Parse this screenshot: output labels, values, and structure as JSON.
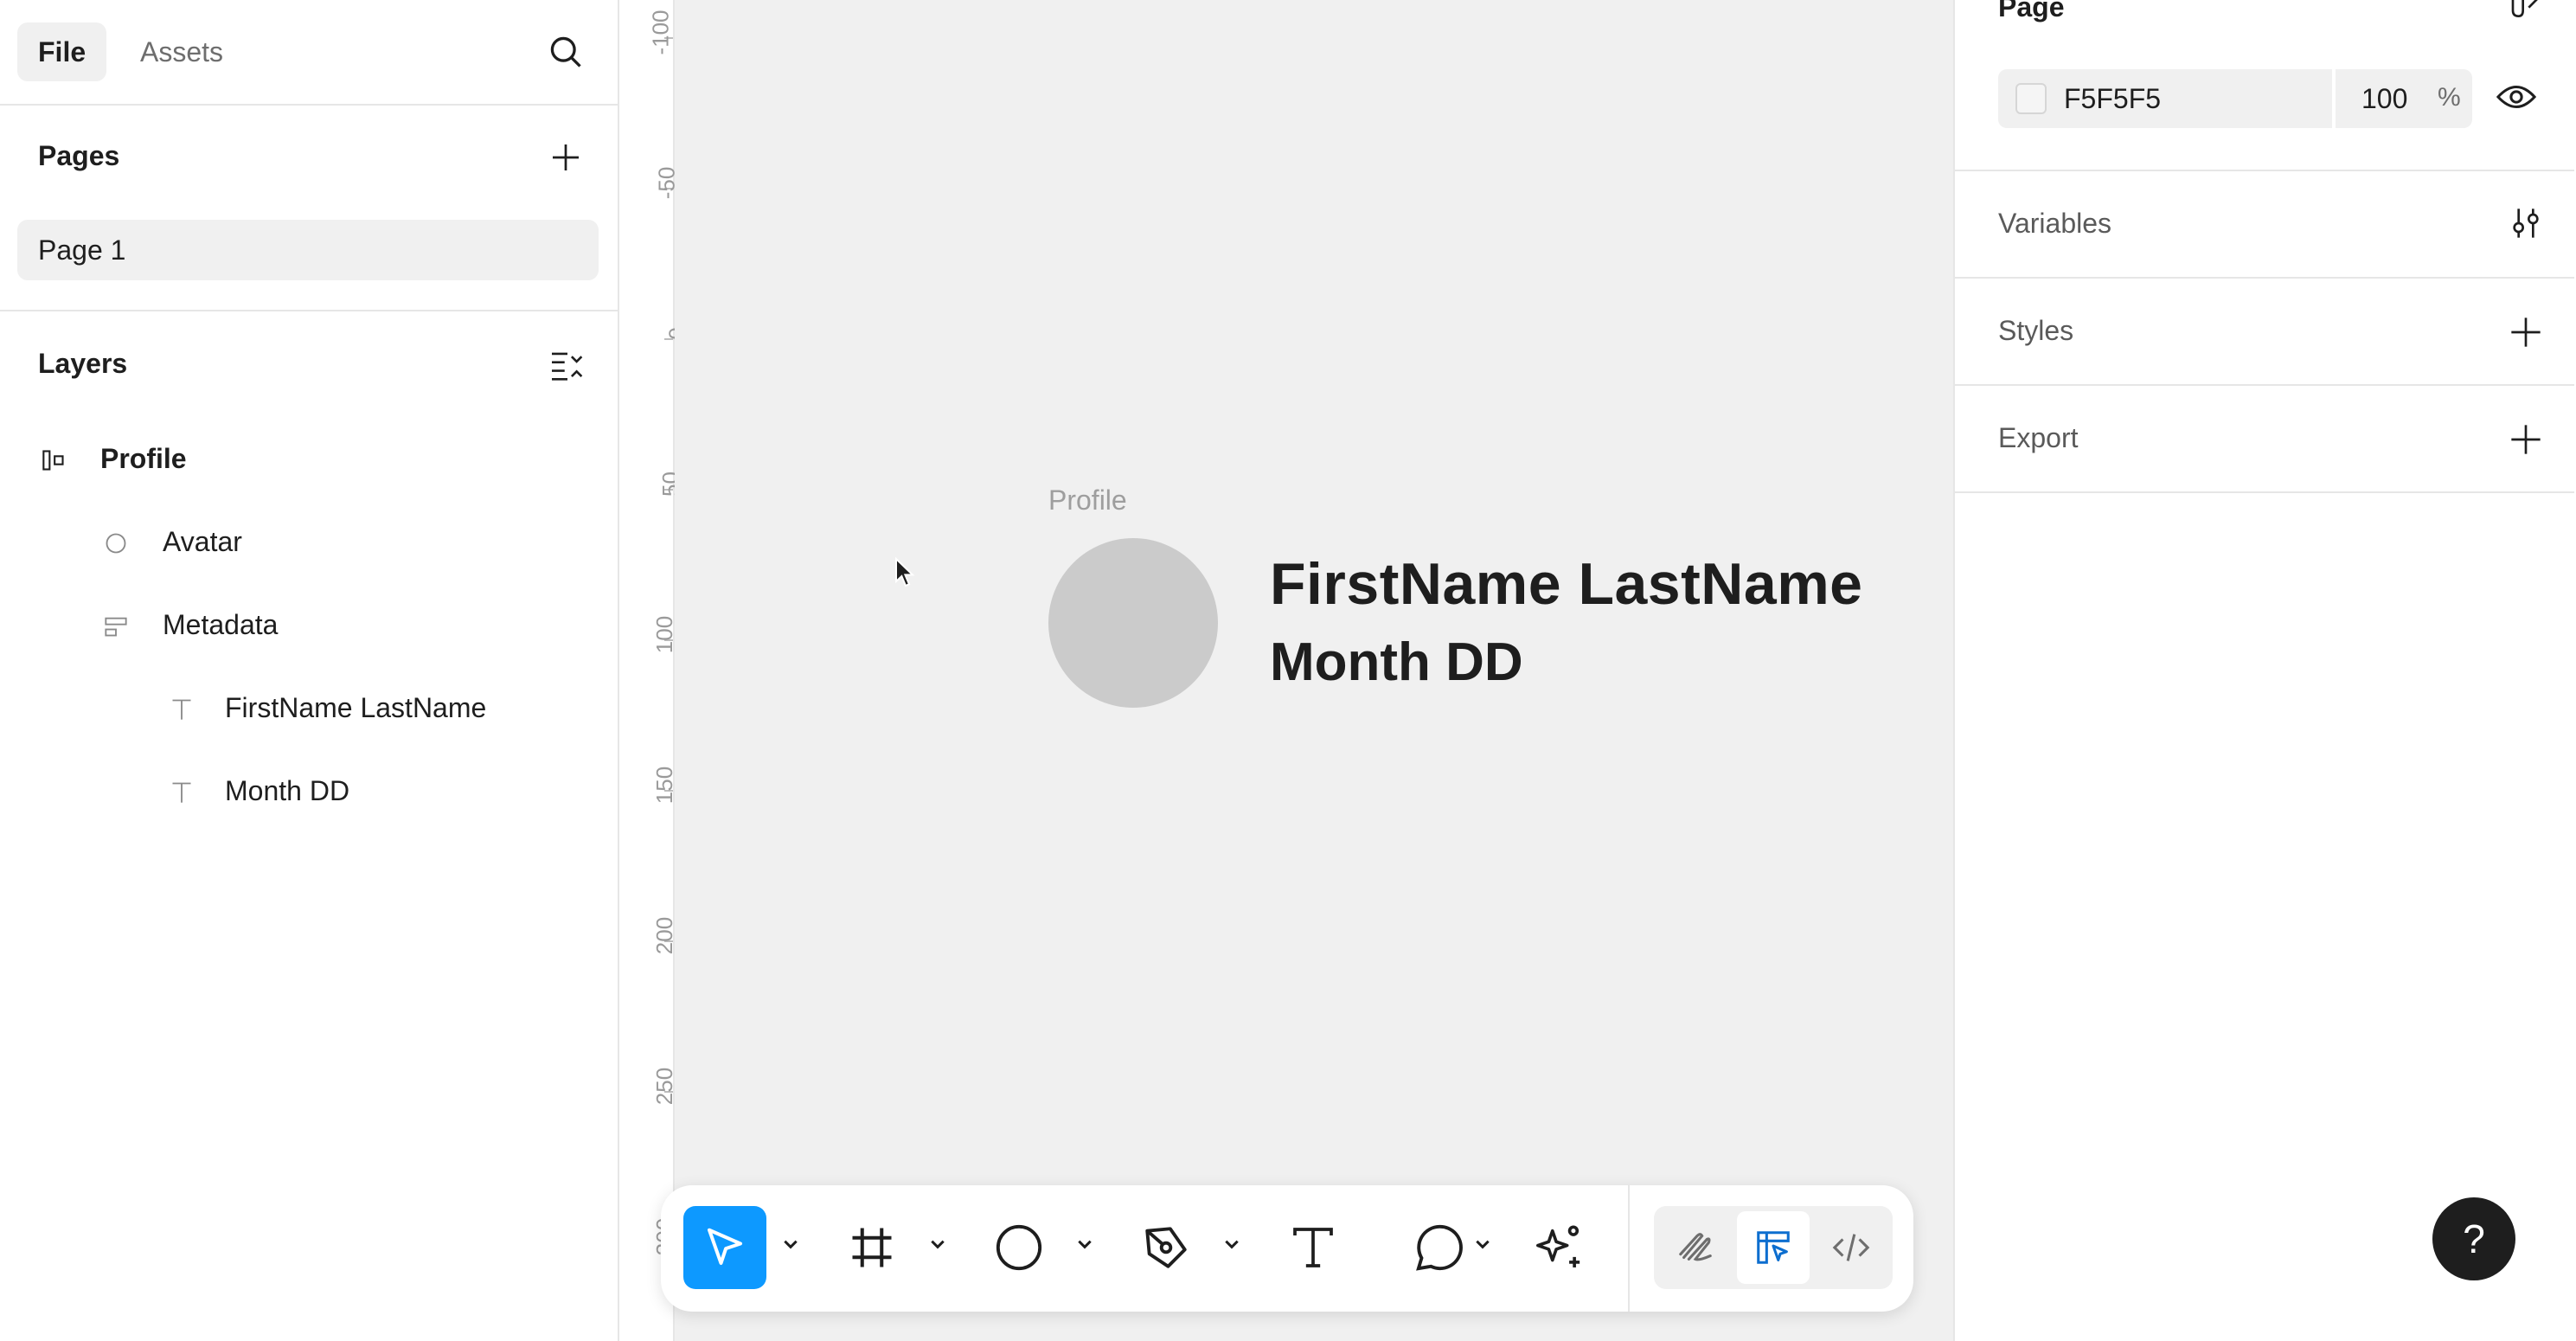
{
  "left_panel": {
    "tabs": {
      "file": "File",
      "assets": "Assets"
    },
    "pages": {
      "title": "Pages",
      "items": [
        "Page 1"
      ]
    },
    "layers": {
      "title": "Layers",
      "items": [
        {
          "label": "Profile",
          "icon": "auto-layout-frame-icon"
        },
        {
          "label": "Avatar",
          "icon": "ellipse-icon"
        },
        {
          "label": "Metadata",
          "icon": "auto-layout-vertical-icon"
        },
        {
          "label": "FirstName LastName",
          "icon": "text-icon"
        },
        {
          "label": "Month DD",
          "icon": "text-icon"
        }
      ]
    }
  },
  "ruler": {
    "labels": [
      "-100",
      "-50",
      "0",
      "50",
      "100",
      "150",
      "200",
      "250",
      "300"
    ]
  },
  "canvas": {
    "frame_label": "Profile",
    "name": "FirstName LastName",
    "date": "Month DD",
    "colors": {
      "background": "#f0f0f0",
      "avatar": "#cbcbcb"
    }
  },
  "toolbar": {
    "tools": [
      "move-tool",
      "frame-tool",
      "shape-tool",
      "pen-tool",
      "text-tool",
      "comment-tool",
      "ai-tool"
    ],
    "modes": [
      "draw-mode",
      "design-mode",
      "dev-mode"
    ],
    "accent": "#0d99ff"
  },
  "right_panel": {
    "page": {
      "title": "Page",
      "color_hex": "F5F5F5",
      "opacity": "100",
      "percent": "%"
    },
    "variables": "Variables",
    "styles": "Styles",
    "export": "Export"
  },
  "help": "?"
}
